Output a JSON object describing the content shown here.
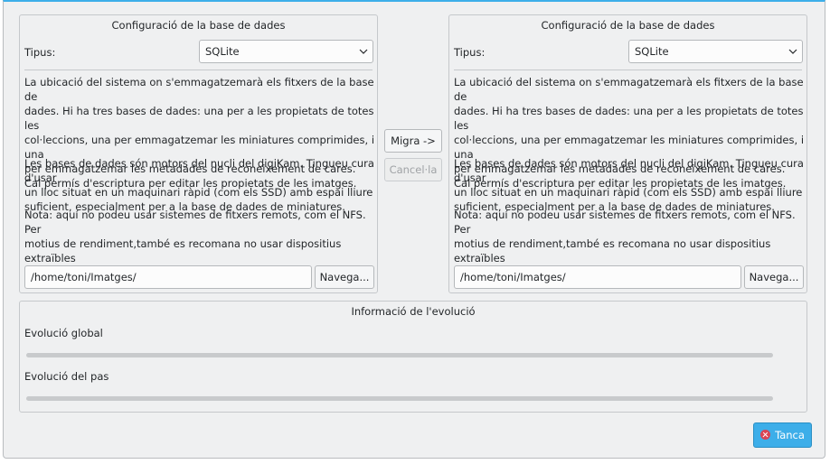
{
  "source_panel": {
    "title": "Configuració de la base de dades",
    "type_label": "Tipus:",
    "type_value": "SQLite",
    "description": "La ubicació del sistema on s'emmagatzemarà els fitxers de la base de\ndades. Hi ha tres bases de dades: una per a les propietats de totes les\ncol·leccions, una per emmagatzemar les miniatures comprimides, i una\nper emmagatzemar les metadades de reconeixement de cares.\nCal permís d'escriptura per editar les propietats de les imatges.",
    "engine_note": "Les bases de dades són motors del nucli del digiKam. Tingueu cura d'usar\nun lloc situat en un maquinari ràpid (com els SSD) amb espai lliure\nsuficient, especialment per a la base de dades de miniatures.",
    "remote_note": "Nota: aquí no podeu usar sistemes de fitxers remots, com el NFS. Per\nmotius de rendiment,també es recomana no usar dispositius extraïbles",
    "path_value": "/home/toni/Imatges/",
    "browse_label": "Navega..."
  },
  "target_panel": {
    "title": "Configuració de la base de dades",
    "type_label": "Tipus:",
    "type_value": "SQLite",
    "description": "La ubicació del sistema on s'emmagatzemarà els fitxers de la base de\ndades. Hi ha tres bases de dades: una per a les propietats de totes les\ncol·leccions, una per emmagatzemar les miniatures comprimides, i una\nper emmagatzemar les metadades de reconeixement de cares.\nCal permís d'escriptura per editar les propietats de les imatges.",
    "engine_note": "Les bases de dades són motors del nucli del digiKam. Tingueu cura d'usar\nun lloc situat en un maquinari ràpid (com els SSD) amb espai lliure\nsuficient, especialment per a la base de dades de miniatures.",
    "remote_note": "Nota: aquí no podeu usar sistemes de fitxers remots, com el NFS. Per\nmotius de rendiment,també es recomana no usar dispositius extraïbles",
    "path_value": "/home/toni/Imatges/",
    "browse_label": "Navega..."
  },
  "actions": {
    "migrate_label": "Migra ->",
    "cancel_label": "Cancel·la"
  },
  "progress_panel": {
    "title": "Informació de l'evolució",
    "overall_label": "Evolució global",
    "overall_value": 0,
    "step_label": "Evolució del pas",
    "step_value": 0
  },
  "footer": {
    "close_label": "Tanca",
    "close_icon": "close-circle-icon"
  },
  "colors": {
    "accent": "#3daee9",
    "close_icon": "#da4453"
  }
}
